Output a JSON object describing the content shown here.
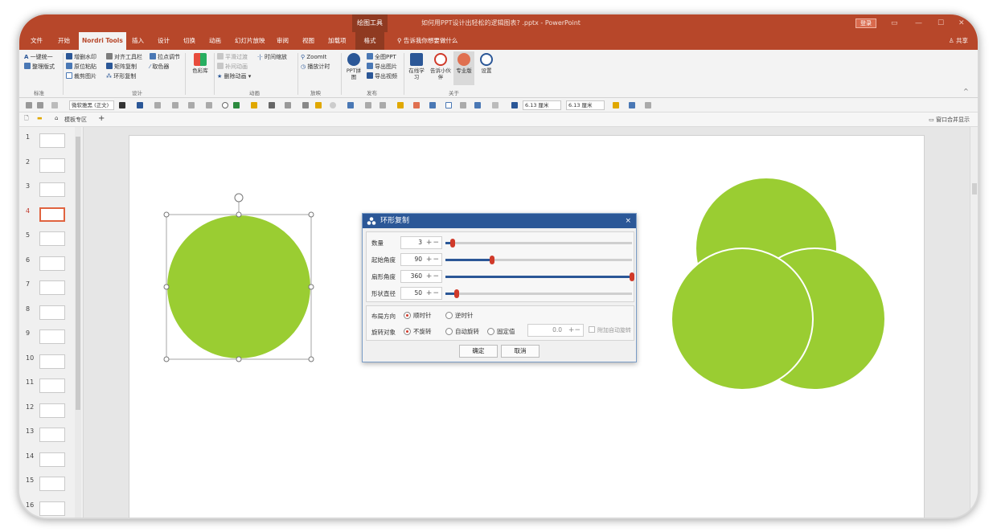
{
  "titlebar": {
    "context_tab": "绘图工具",
    "doc_title": "如何用PPT设计出轻松的逻辑图表? .pptx  -  PowerPoint",
    "login": "登录",
    "win_min": "—",
    "win_max": "☐",
    "win_close": "✕"
  },
  "menu": {
    "tabs": [
      "文件",
      "开始",
      "Nordri Tools",
      "插入",
      "设计",
      "切换",
      "动画",
      "幻灯片放映",
      "审阅",
      "视图",
      "加载项",
      "格式"
    ],
    "tell_me": "告诉我你想要做什么",
    "share": "共享"
  },
  "ribbon": {
    "g1": {
      "items": [
        "一键统一",
        "整理版式"
      ],
      "label": "标准"
    },
    "g2": {
      "items": [
        "增删水印",
        "对齐工具栏",
        "拉点调节",
        "原位粘贴",
        "矩阵复制",
        "取色器",
        "裁剪图片",
        "环形复制"
      ],
      "label": "设计"
    },
    "g3": {
      "big": "色彩库"
    },
    "g4": {
      "items": [
        "平滑过渡",
        "时间缩放",
        "补间动画",
        "删除动画"
      ],
      "label": "动画"
    },
    "g5": {
      "items": [
        "ZoomIt",
        "播放计时"
      ],
      "label": "放映"
    },
    "g6": {
      "big": "PPT拼图",
      "items": [
        "全图PPT",
        "导出图片",
        "导出视频"
      ],
      "label": "发布"
    },
    "g7": {
      "bigs": [
        "在线学习",
        "告诉小伙伴",
        "专业版",
        "设置"
      ],
      "label": "关于"
    }
  },
  "toolbar": {
    "font": "微软雅黑 (正文)",
    "width": "6.13 厘米",
    "height": "6.13 厘米"
  },
  "template_bar": {
    "zone": "模板专区",
    "merge": "窗口合并显示"
  },
  "thumbnails": [
    "1",
    "2",
    "3",
    "4",
    "5",
    "6",
    "7",
    "8",
    "9",
    "10",
    "11",
    "12",
    "13",
    "14",
    "15",
    "16"
  ],
  "selected_slide": "4",
  "dialog": {
    "title": "环形复制",
    "close": "×",
    "params": [
      {
        "label": "数量",
        "value": "3",
        "fraction": 0.04
      },
      {
        "label": "起始角度",
        "value": "90",
        "fraction": 0.25
      },
      {
        "label": "扇形角度",
        "value": "360",
        "fraction": 1.0
      },
      {
        "label": "形状直径",
        "value": "50",
        "fraction": 0.06
      }
    ],
    "direction_label": "布局方向",
    "direction_options": [
      "顺时针",
      "逆时针"
    ],
    "rotate_label": "旋转对象",
    "rotate_options": [
      "不旋转",
      "自动旋转",
      "固定值"
    ],
    "fixed_value": "0.0",
    "extra_rotate": "附加自动旋转",
    "ok": "确定",
    "cancel": "取消"
  },
  "colors": {
    "accent": "#b7472a",
    "circle_fill": "#9acd32",
    "dialog_header": "#2b5797",
    "slider_knob": "#d03a2a"
  }
}
